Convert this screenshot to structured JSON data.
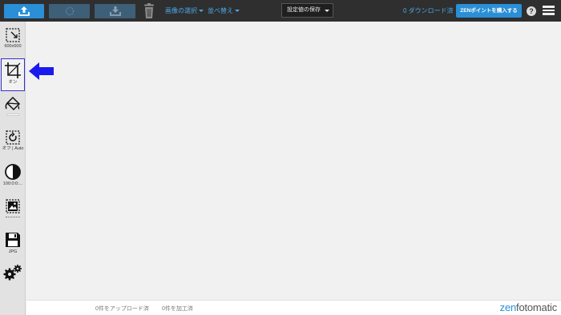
{
  "toolbar": {
    "upload_icon": "upload-icon",
    "process_icon": "spinner-icon",
    "download_icon": "download-icon",
    "trash_icon": "trash-icon",
    "select_images": "画像の選択",
    "sort": "並べ替え",
    "save_settings": "設定値の保存",
    "download_count": "0 ダウンロード済",
    "buy_points": "ZENポイントを購入する",
    "help": "?",
    "menu_icon": "hamburger-icon",
    "colors": {
      "bar": "#2f2f2f",
      "accent": "#2a8fd6",
      "link": "#4aa8e8"
    }
  },
  "sidebar": {
    "tools": [
      {
        "name": "resize",
        "icon": "resize-icon",
        "label": "600x500"
      },
      {
        "name": "crop",
        "icon": "crop-icon",
        "label": "オン",
        "selected": true
      },
      {
        "name": "background",
        "icon": "paint-bucket-icon",
        "label": ""
      },
      {
        "name": "rotate",
        "icon": "rotate-icon",
        "label": "オフ | Auto"
      },
      {
        "name": "adjust",
        "icon": "contrast-icon",
        "label": "100:0:0:..."
      },
      {
        "name": "watermark",
        "icon": "image-icon",
        "label": ""
      },
      {
        "name": "save-format",
        "icon": "floppy-icon",
        "label": "JPG"
      },
      {
        "name": "settings",
        "icon": "gears-icon",
        "label": ""
      }
    ]
  },
  "footer": {
    "uploaded": "0件をアップロード済",
    "processed": "0件を加工済",
    "logo_zen": "zen",
    "logo_rest": "fotomatic"
  },
  "arrow_color": "#1a1aee"
}
